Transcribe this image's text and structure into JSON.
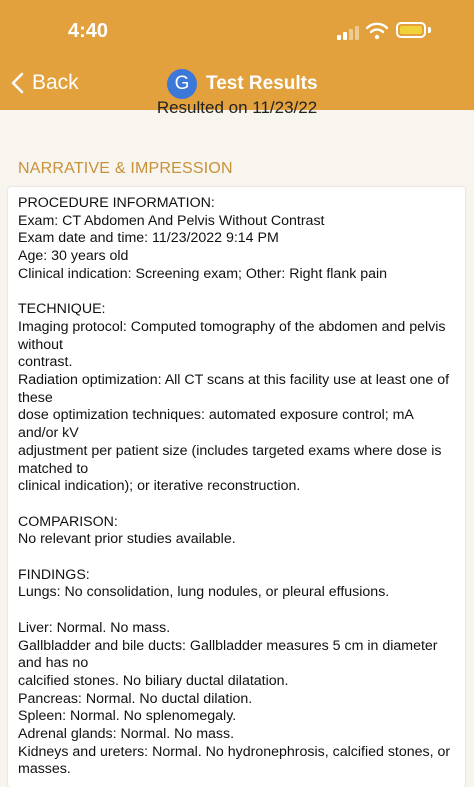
{
  "status_bar": {
    "time": "4:40",
    "battery_color": "#f2d23a"
  },
  "nav": {
    "back_label": "Back",
    "avatar_letter": "G",
    "title": "Test Results",
    "header_color": "#e2a13c"
  },
  "resulted_text": "Resulted on 11/23/22",
  "section_heading": "NARRATIVE & IMPRESSION",
  "report": {
    "procedure": {
      "heading": "PROCEDURE INFORMATION:",
      "lines": [
        "Exam: CT Abdomen And Pelvis Without Contrast",
        "Exam date and time: 11/23/2022 9:14 PM",
        "Age: 30 years old",
        "Clinical indication: Screening exam; Other: Right flank pain"
      ]
    },
    "technique": {
      "heading": "TECHNIQUE:",
      "lines": [
        "Imaging protocol: Computed tomography of the abdomen and pelvis",
        "without",
        "contrast.",
        "Radiation optimization: All CT scans at this facility use at least one of",
        "these",
        "dose optimization techniques: automated exposure control; mA",
        "and/or kV",
        "adjustment per patient size (includes targeted exams where dose is",
        "matched to",
        "clinical indication); or iterative reconstruction."
      ]
    },
    "comparison": {
      "heading": "COMPARISON:",
      "lines": [
        "No relevant prior studies available."
      ]
    },
    "findings": {
      "heading": "FINDINGS:",
      "lines_a": [
        "Lungs: No consolidation, lung nodules, or pleural effusions."
      ],
      "lines_b": [
        "Liver: Normal. No mass.",
        "Gallbladder and bile ducts: Gallbladder measures 5 cm in diameter",
        "and has no",
        "calcified stones. No biliary ductal dilatation.",
        "Pancreas: Normal. No ductal dilation.",
        "Spleen: Normal. No splenomegaly.",
        "Adrenal glands: Normal. No mass.",
        "Kidneys and ureters: Normal. No hydronephrosis, calcified stones, or",
        "masses."
      ]
    }
  }
}
